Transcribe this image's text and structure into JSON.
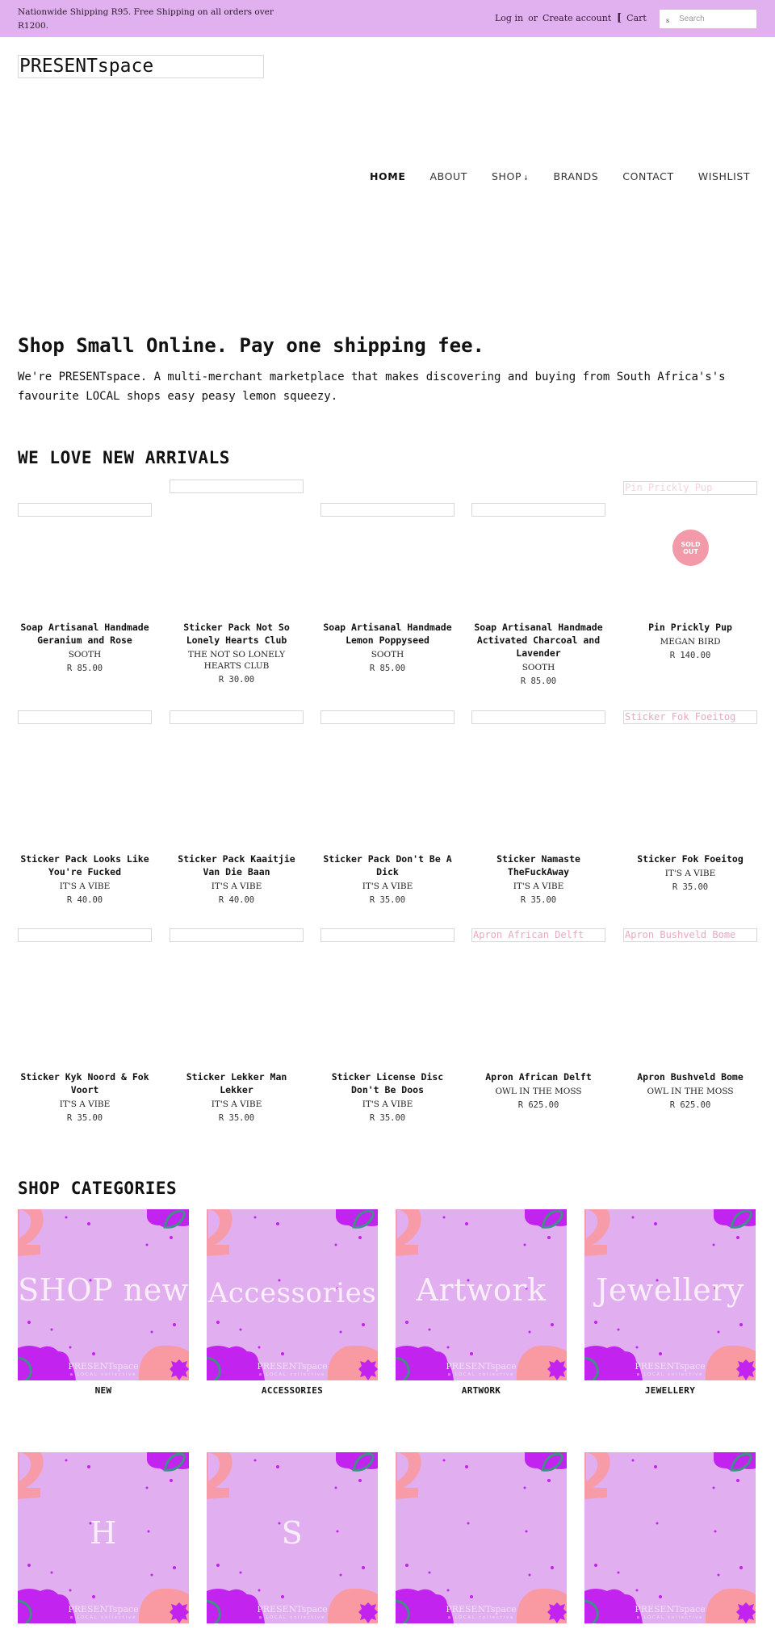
{
  "topbar": {
    "announcement": "Nationwide Shipping R95. Free Shipping on all orders over R1200.",
    "login": "Log in",
    "or": "or",
    "create_account": "Create account",
    "cart_icon": "[",
    "cart": "Cart",
    "search_icon": "s",
    "search_placeholder": "Search"
  },
  "logo": "PRESENTspace",
  "nav": {
    "items": [
      {
        "label": "HOME",
        "active": true
      },
      {
        "label": "ABOUT"
      },
      {
        "label": "SHOP",
        "caret": "↓"
      },
      {
        "label": "BRANDS"
      },
      {
        "label": "CONTACT"
      },
      {
        "label": "WISHLIST"
      }
    ]
  },
  "hero": {
    "title": "Shop Small Online. Pay one shipping fee.",
    "text": "We're PRESENTspace. A multi-merchant marketplace that makes discovering and buying from South Africa's's favourite LOCAL shops easy peasy lemon squeezy."
  },
  "new_arrivals": {
    "title": "WE LOVE NEW ARRIVALS",
    "products": [
      {
        "title": "Soap Artisanal Handmade Geranium and Rose",
        "vendor": "SOOTH",
        "price": "R 85.00",
        "alt": ""
      },
      {
        "title": "Sticker Pack Not So Lonely Hearts Club",
        "vendor": "THE NOT SO LONELY HEARTS CLUB",
        "price": "R 30.00",
        "alt": ""
      },
      {
        "title": "Soap Artisanal Handmade Lemon Poppyseed",
        "vendor": "SOOTH",
        "price": "R 85.00",
        "alt": ""
      },
      {
        "title": "Soap Artisanal Handmade Activated Charcoal and Lavender",
        "vendor": "SOOTH",
        "price": "R 85.00",
        "alt": ""
      },
      {
        "title": "Pin Prickly Pup",
        "vendor": "MEGAN BIRD",
        "price": "R 140.00",
        "alt": "Pin Prickly Pup",
        "badge": "SOLD OUT"
      },
      {
        "title": "Sticker Pack Looks Like You're Fucked",
        "vendor": "IT'S A VIBE",
        "price": "R 40.00",
        "alt": ""
      },
      {
        "title": "Sticker Pack Kaaitjie Van Die Baan",
        "vendor": "IT'S A VIBE",
        "price": "R 40.00",
        "alt": ""
      },
      {
        "title": "Sticker Pack Don't Be A Dick",
        "vendor": "IT'S A VIBE",
        "price": "R 35.00",
        "alt": ""
      },
      {
        "title": "Sticker Namaste TheFuckAway",
        "vendor": "IT'S A VIBE",
        "price": "R 35.00",
        "alt": ""
      },
      {
        "title": "Sticker Fok Foeitog",
        "vendor": "IT'S A VIBE",
        "price": "R 35.00",
        "alt": "Sticker Fok Foeitog"
      },
      {
        "title": "Sticker Kyk Noord & Fok Voort",
        "vendor": "IT'S A VIBE",
        "price": "R 35.00",
        "alt": ""
      },
      {
        "title": "Sticker Lekker Man Lekker",
        "vendor": "IT'S A VIBE",
        "price": "R 35.00",
        "alt": ""
      },
      {
        "title": "Sticker License Disc Don't Be Doos",
        "vendor": "IT'S A VIBE",
        "price": "R 35.00",
        "alt": ""
      },
      {
        "title": "Apron African Delft",
        "vendor": "OWL IN THE MOSS",
        "price": "R 625.00",
        "alt": "Apron African Delft"
      },
      {
        "title": "Apron Bushveld Bome",
        "vendor": "OWL IN THE MOSS",
        "price": "R 625.00",
        "alt": "Apron Bushveld Bome"
      }
    ]
  },
  "categories": {
    "title": "SHOP CATEGORIES",
    "tile_brand": "PRESENTspace",
    "tile_tagline": "a LOCAL collective",
    "items": [
      {
        "tile_text": "SHOP new",
        "label": "NEW"
      },
      {
        "tile_text": "Accessories",
        "label": "ACCESSORIES"
      },
      {
        "tile_text": "Artwork",
        "label": "ARTWORK"
      },
      {
        "tile_text": "Jewellery",
        "label": "JEWELLERY"
      },
      {
        "tile_text": "H",
        "label": ""
      },
      {
        "tile_text": "S",
        "label": ""
      },
      {
        "tile_text": "",
        "label": ""
      },
      {
        "tile_text": "",
        "label": ""
      }
    ]
  },
  "colors": {
    "topbar_bg": "#e1b0ef",
    "tile_bg": "#e1aef0",
    "sold_out": "#f29aa7",
    "alt_text": "#e7a9bb",
    "blob_purple": "#c223ef",
    "blob_pink": "#f999a1",
    "loop_teal": "#3f8f86"
  }
}
